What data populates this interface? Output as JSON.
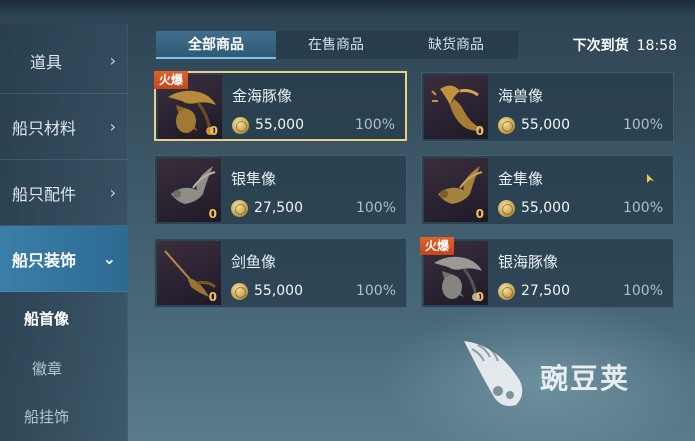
{
  "sidebar": {
    "categories": [
      {
        "label": "道具",
        "chevron": "›"
      },
      {
        "label": "船只材料",
        "chevron": "›"
      },
      {
        "label": "船只配件",
        "chevron": "›"
      },
      {
        "label": "船只装饰",
        "chevron": "⌄"
      }
    ],
    "subitems": [
      {
        "label": "船首像"
      },
      {
        "label": "徽章"
      },
      {
        "label": "船挂饰"
      }
    ]
  },
  "tabs": [
    {
      "label": "全部商品"
    },
    {
      "label": "在售商品"
    },
    {
      "label": "缺货商品"
    }
  ],
  "restock": {
    "label": "下次到货",
    "time": "18:58"
  },
  "items": [
    {
      "name": "金海豚像",
      "price": "55,000",
      "percent": "100%",
      "quantity": "0",
      "badge": "火爆",
      "icon": "golden-dolphin-figurehead-icon"
    },
    {
      "name": "海兽像",
      "price": "55,000",
      "percent": "100%",
      "quantity": "0",
      "badge": "",
      "icon": "sea-beast-figurehead-icon"
    },
    {
      "name": "银隼像",
      "price": "27,500",
      "percent": "100%",
      "quantity": "0",
      "badge": "",
      "icon": "silver-falcon-figurehead-icon"
    },
    {
      "name": "金隼像",
      "price": "55,000",
      "percent": "100%",
      "quantity": "0",
      "badge": "",
      "icon": "golden-falcon-figurehead-icon"
    },
    {
      "name": "剑鱼像",
      "price": "55,000",
      "percent": "100%",
      "quantity": "0",
      "badge": "",
      "icon": "swordfish-figurehead-icon"
    },
    {
      "name": "银海豚像",
      "price": "27,500",
      "percent": "100%",
      "quantity": "0",
      "badge": "火爆",
      "icon": "silver-dolphin-figurehead-icon"
    }
  ],
  "watermark": {
    "text": "豌豆荚"
  },
  "colors": {
    "accent": "#3a7fa8",
    "selected_border": "#e9cf8a",
    "badge": "#d4511f",
    "quantity": "#f0c35b"
  }
}
